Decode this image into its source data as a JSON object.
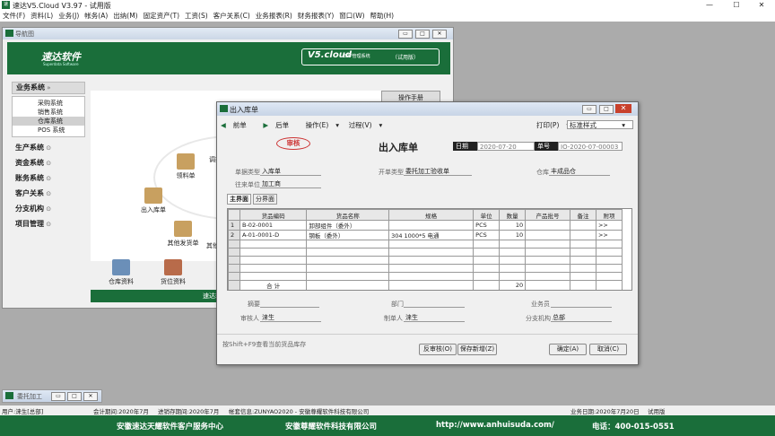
{
  "app": {
    "title": "速达V5.Cloud V3.97 - 试用版",
    "icon": "速达"
  },
  "menu": [
    "文件(F)",
    "资料(L)",
    "业务(J)",
    "帐务(A)",
    "出纳(M)",
    "固定资产(T)",
    "工资(S)",
    "客户关系(C)",
    "业务报表(R)",
    "财务报表(Y)",
    "窗口(W)",
    "帮助(H)"
  ],
  "nav": {
    "title": "导航图",
    "brand": "速达软件",
    "brand_sub": "Superdata Software",
    "ver": "V5.cloud",
    "ver_sub": "ERP管理系统",
    "ver_trial": "（试用版）",
    "manual": "操作手册",
    "groups": [
      {
        "label": "业务系统",
        "expanded": true,
        "subs": [
          "采购系统",
          "销售系统",
          "仓库系统",
          "POS 系统"
        ],
        "selected": 2
      },
      {
        "label": "生产系统"
      },
      {
        "label": "资金系统"
      },
      {
        "label": "账务系统"
      },
      {
        "label": "客户关系"
      },
      {
        "label": "分支机构"
      },
      {
        "label": "项目管理"
      }
    ],
    "flow": [
      "出入库单",
      "领料单",
      "调拨",
      "其他发货单",
      "其他"
    ],
    "bottom": [
      "仓库资料",
      "货位资料"
    ],
    "footer": "速达软件技"
  },
  "dialog": {
    "title": "出入库单",
    "toolbar": {
      "prev": "前单",
      "next": "后单",
      "op": "操作(E)",
      "process": "过程(V)",
      "print": "打印(P)",
      "print_style": "标准样式"
    },
    "stamp": "审核",
    "heading": "出入库单",
    "date_label": "日期",
    "date": "2020-07-20",
    "no_label": "单号",
    "no": "IO-2020-07-00003",
    "doc_type_label": "单据类型",
    "doc_type": "入库单",
    "src_type_label": "开单类型",
    "src_type": "委托加工验收单",
    "warehouse_label": "仓库",
    "warehouse": "丰成品仓",
    "unit_label": "往来单位",
    "unit": "加工商",
    "tabs": [
      "主界面",
      "分界面"
    ],
    "columns": [
      "货品编码",
      "货品名称",
      "规格",
      "单位",
      "数量",
      "产品批号",
      "备注",
      "附项"
    ],
    "rows": [
      {
        "n": "1",
        "code": "B-02-0001",
        "name": "卸部组件（委外）",
        "spec": "",
        "unit": "PCS",
        "qty": "10",
        "batch": "",
        "note": "",
        "extra": ">>"
      },
      {
        "n": "2",
        "code": "A-01-0001-D",
        "name": "钢板（委外）",
        "spec": "304 1000*5 电通",
        "unit": "PCS",
        "qty": "10",
        "batch": "",
        "note": "",
        "extra": ">>"
      }
    ],
    "total_label": "合 计",
    "total_qty": "20",
    "memo_label": "摘要",
    "dept_label": "部门",
    "salesman_label": "业务员",
    "auditor_label": "审核人",
    "auditor": "涞生",
    "maker_label": "制单人",
    "maker": "涞生",
    "branch_label": "分支机构",
    "branch": "总部",
    "hint": "按Shift+F9查看当前货品库存",
    "btn_unaudit": "反审核(O)",
    "btn_savenew": "保存新增(Z)",
    "btn_ok": "确定(A)",
    "btn_cancel": "取消(C)"
  },
  "minwin": {
    "title": "委托加工"
  },
  "status": {
    "user": "用户:涞生[总部]",
    "period": "会计期间:2020年7月",
    "stock_period": "进销存期间:2020年7月",
    "account": "帐套信息:ZUNYAO2020 - 安徽尊耀软件科技有限公司",
    "date": "业务日期:2020年7月20日",
    "mode": "试用版"
  },
  "footer": {
    "a": "安徽速达天耀软件客户服务中心",
    "b": "安徽尊耀软件科技有限公司",
    "c": "http://www.anhuisuda.com/",
    "d": "电话：400-015-0551"
  }
}
